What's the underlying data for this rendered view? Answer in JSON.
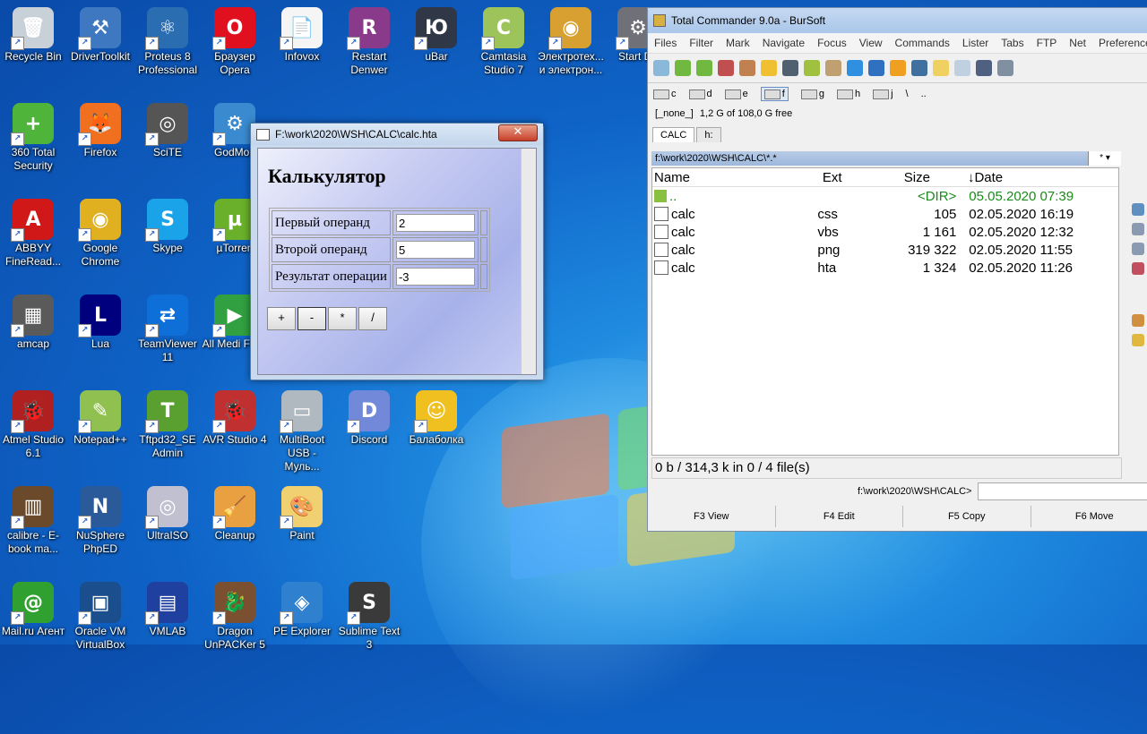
{
  "desktop": {
    "icons": [
      {
        "label": "Recycle Bin",
        "color": "#c8d0d8",
        "glyph": "🗑",
        "col": 0,
        "row": 0
      },
      {
        "label": "DriverToolkit",
        "color": "#3d78c0",
        "glyph": "⚒",
        "col": 1,
        "row": 0
      },
      {
        "label": "Proteus 8 Professional",
        "color": "#2a6db0",
        "glyph": "⚛",
        "col": 2,
        "row": 0
      },
      {
        "label": "Браузер Opera",
        "color": "#e0101f",
        "glyph": "O",
        "col": 3,
        "row": 0
      },
      {
        "label": "Infovox",
        "color": "#f5f5f5",
        "glyph": "📄",
        "col": 4,
        "row": 0
      },
      {
        "label": "Restart Denwer",
        "color": "#8a3a8a",
        "glyph": "R",
        "col": 5,
        "row": 0
      },
      {
        "label": "uBar",
        "color": "#303848",
        "glyph": "Ю",
        "col": 6,
        "row": 0
      },
      {
        "label": "Camtasia Studio 7",
        "color": "#9cc45a",
        "glyph": "C",
        "col": 7,
        "row": 0
      },
      {
        "label": "Электротех... и электрон...",
        "color": "#d8a030",
        "glyph": "◉",
        "col": 8,
        "row": 0
      },
      {
        "label": "Start De",
        "color": "#707078",
        "glyph": "⚙",
        "col": 9,
        "row": 0
      },
      {
        "label": "360 Total Security",
        "color": "#4fb43a",
        "glyph": "+",
        "col": 0,
        "row": 1
      },
      {
        "label": "Firefox",
        "color": "#f07020",
        "glyph": "🦊",
        "col": 1,
        "row": 1
      },
      {
        "label": "SciTE",
        "color": "#555",
        "glyph": "◎",
        "col": 2,
        "row": 1
      },
      {
        "label": "GodMou",
        "color": "#3a8ad0",
        "glyph": "⚙",
        "col": 3,
        "row": 1
      },
      {
        "label": "ABBYY FineRead...",
        "color": "#d01818",
        "glyph": "A",
        "col": 0,
        "row": 2
      },
      {
        "label": "Google Chrome",
        "color": "#e0b020",
        "glyph": "◉",
        "col": 1,
        "row": 2
      },
      {
        "label": "Skype",
        "color": "#1aa3e8",
        "glyph": "S",
        "col": 2,
        "row": 2
      },
      {
        "label": "µTorren",
        "color": "#6ab02a",
        "glyph": "µ",
        "col": 3,
        "row": 2
      },
      {
        "label": "amcap",
        "color": "#5a5a5a",
        "glyph": "▦",
        "col": 0,
        "row": 3
      },
      {
        "label": "Lua",
        "color": "#00007f",
        "glyph": "L",
        "col": 1,
        "row": 3
      },
      {
        "label": "TeamViewer 11",
        "color": "#0e6fd8",
        "glyph": "⇄",
        "col": 2,
        "row": 3
      },
      {
        "label": "All Medi Fixer",
        "color": "#30a040",
        "glyph": "▶",
        "col": 3,
        "row": 3
      },
      {
        "label": "Atmel Studio 6.1",
        "color": "#b02020",
        "glyph": "🐞",
        "col": 0,
        "row": 4
      },
      {
        "label": "Notepad++",
        "color": "#90c050",
        "glyph": "✎",
        "col": 1,
        "row": 4
      },
      {
        "label": "Tftpd32_SE Admin",
        "color": "#5aa030",
        "glyph": "T",
        "col": 2,
        "row": 4
      },
      {
        "label": "AVR Studio 4",
        "color": "#c03030",
        "glyph": "🐞",
        "col": 3,
        "row": 4
      },
      {
        "label": "MultiBoot USB - Муль...",
        "color": "#b0b8c0",
        "glyph": "▭",
        "col": 4,
        "row": 4
      },
      {
        "label": "Discord",
        "color": "#7289da",
        "glyph": "D",
        "col": 5,
        "row": 4
      },
      {
        "label": "Балаболка",
        "color": "#f0c020",
        "glyph": "☺",
        "col": 6,
        "row": 4
      },
      {
        "label": "calibre - E-book ma...",
        "color": "#6a4a2a",
        "glyph": "▥",
        "col": 0,
        "row": 5
      },
      {
        "label": "NuSphere PhpED",
        "color": "#2a5a9a",
        "glyph": "N",
        "col": 1,
        "row": 5
      },
      {
        "label": "UltraISO",
        "color": "#c0c0d0",
        "glyph": "◎",
        "col": 2,
        "row": 5
      },
      {
        "label": "Cleanup",
        "color": "#e8a040",
        "glyph": "🧹",
        "col": 3,
        "row": 5
      },
      {
        "label": "Paint",
        "color": "#f0d070",
        "glyph": "🎨",
        "col": 4,
        "row": 5
      },
      {
        "label": "Mail.ru Агент",
        "color": "#30a030",
        "glyph": "@",
        "col": 0,
        "row": 6
      },
      {
        "label": "Oracle VM VirtualBox",
        "color": "#1a4e8c",
        "glyph": "▣",
        "col": 1,
        "row": 6
      },
      {
        "label": "VMLAB",
        "color": "#2040a0",
        "glyph": "▤",
        "col": 2,
        "row": 6
      },
      {
        "label": "Dragon UnPACKer 5",
        "color": "#7a5030",
        "glyph": "🐉",
        "col": 3,
        "row": 6
      },
      {
        "label": "PE Explorer",
        "color": "#3080d0",
        "glyph": "◈",
        "col": 4,
        "row": 6
      },
      {
        "label": "Sublime Text 3",
        "color": "#3a3a3a",
        "glyph": "S",
        "col": 5,
        "row": 6
      }
    ]
  },
  "hta": {
    "title": "F:\\work\\2020\\WSH\\CALC\\calc.hta",
    "close_label": "✕",
    "heading": "Калькулятор",
    "label_first": "Первый операнд",
    "label_second": "Второй операнд",
    "label_result": "Результат операции",
    "value_first": "2",
    "value_second": "5",
    "value_result": "-3",
    "btn_add": "+",
    "btn_sub": "-",
    "btn_mul": "*",
    "btn_div": "/"
  },
  "tc": {
    "title": "Total Commander 9.0a - BurSoft",
    "menu": [
      "Files",
      "Filter",
      "Mark",
      "Navigate",
      "Focus",
      "View",
      "Commands",
      "Lister",
      "Tabs",
      "FTP",
      "Net",
      "Preferences"
    ],
    "drives": [
      "c",
      "d",
      "e",
      "f",
      "g",
      "h",
      "j",
      "\\",
      ".."
    ],
    "selected_drive": "f",
    "drive_combo": "[_none_]",
    "free_info": "1,2 G of 108,0 G free",
    "tabs": [
      "CALC",
      "h:"
    ],
    "path": "f:\\work\\2020\\WSH\\CALC\\*.*",
    "sort_label": "*",
    "columns": {
      "name": "Name",
      "ext": "Ext",
      "size": "Size",
      "date": "Date"
    },
    "files": [
      {
        "name": "..",
        "ext": "",
        "size": "<DIR>",
        "date": "05.05.2020 07:39",
        "type": "up"
      },
      {
        "name": "calc",
        "ext": "css",
        "size": "105",
        "date": "02.05.2020 16:19",
        "type": "css"
      },
      {
        "name": "calc",
        "ext": "vbs",
        "size": "1 161",
        "date": "02.05.2020 12:32",
        "type": "vbs"
      },
      {
        "name": "calc",
        "ext": "png",
        "size": "319 322",
        "date": "02.05.2020 11:55",
        "type": "png"
      },
      {
        "name": "calc",
        "ext": "hta",
        "size": "1 324",
        "date": "02.05.2020 11:26",
        "type": "hta"
      }
    ],
    "status": "0 b / 314,3 k in 0 / 4 file(s)",
    "cmd_prompt": "f:\\work\\2020\\WSH\\CALC>",
    "fkeys": [
      "F3 View",
      "F4 Edit",
      "F5 Copy",
      "F6 Move"
    ]
  }
}
